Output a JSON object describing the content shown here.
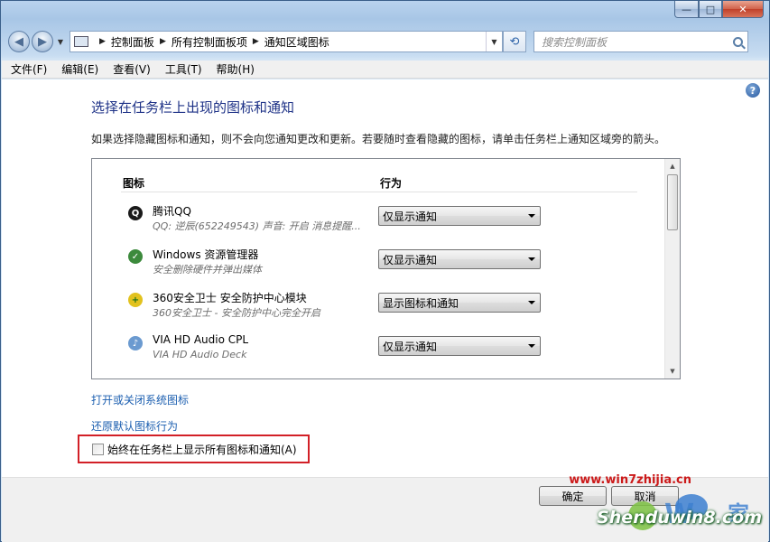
{
  "window": {
    "caption": {
      "minimize": "—",
      "maximize": "□",
      "close": "✕"
    }
  },
  "nav": {
    "back": "◀",
    "forward": "▶",
    "breadcrumb": [
      "控制面板",
      "所有控制面板项",
      "通知区域图标"
    ],
    "search_placeholder": "搜索控制面板"
  },
  "menu": [
    "文件(F)",
    "编辑(E)",
    "查看(V)",
    "工具(T)",
    "帮助(H)"
  ],
  "page": {
    "title": "选择在任务栏上出现的图标和通知",
    "description": "如果选择隐藏图标和通知，则不会向您通知更改和更新。若要随时查看隐藏的图标，请单击任务栏上通知区域旁的箭头。",
    "columns": {
      "icon": "图标",
      "behavior": "行为"
    },
    "rows": [
      {
        "name": "腾讯QQ",
        "sub": "QQ: 逆辰(652249543)  声音: 开启  消息提醒...",
        "behavior": "仅显示通知",
        "icon": "qq-penguin-icon",
        "color": "#1a1a1a"
      },
      {
        "name": "Windows 资源管理器",
        "sub": "安全删除硬件并弹出媒体",
        "behavior": "仅显示通知",
        "icon": "usb-safe-remove-icon",
        "color": "#3c8a3c"
      },
      {
        "name": "360安全卫士 安全防护中心模块",
        "sub": "360安全卫士 - 安全防护中心完全开启",
        "behavior": "显示图标和通知",
        "icon": "360-shield-icon",
        "color": "#2c9a2c"
      },
      {
        "name": "VIA HD Audio CPL",
        "sub": "VIA HD Audio Deck",
        "behavior": "仅显示通知",
        "icon": "audio-icon",
        "color": "#6b9ad0"
      }
    ],
    "link_system_icons": "打开或关闭系统图标",
    "link_restore": "还原默认图标行为",
    "checkbox_label": "始终在任务栏上显示所有图标和通知(A)",
    "checkbox_checked": false
  },
  "buttons": {
    "ok": "确定",
    "cancel": "取消"
  },
  "watermark": {
    "url": "www.win7zhijia.cn",
    "site": "Shenduwin8.com"
  },
  "colors": {
    "title": "#1e3287",
    "link": "#1c5fb0",
    "highlight_box": "#d22027"
  }
}
